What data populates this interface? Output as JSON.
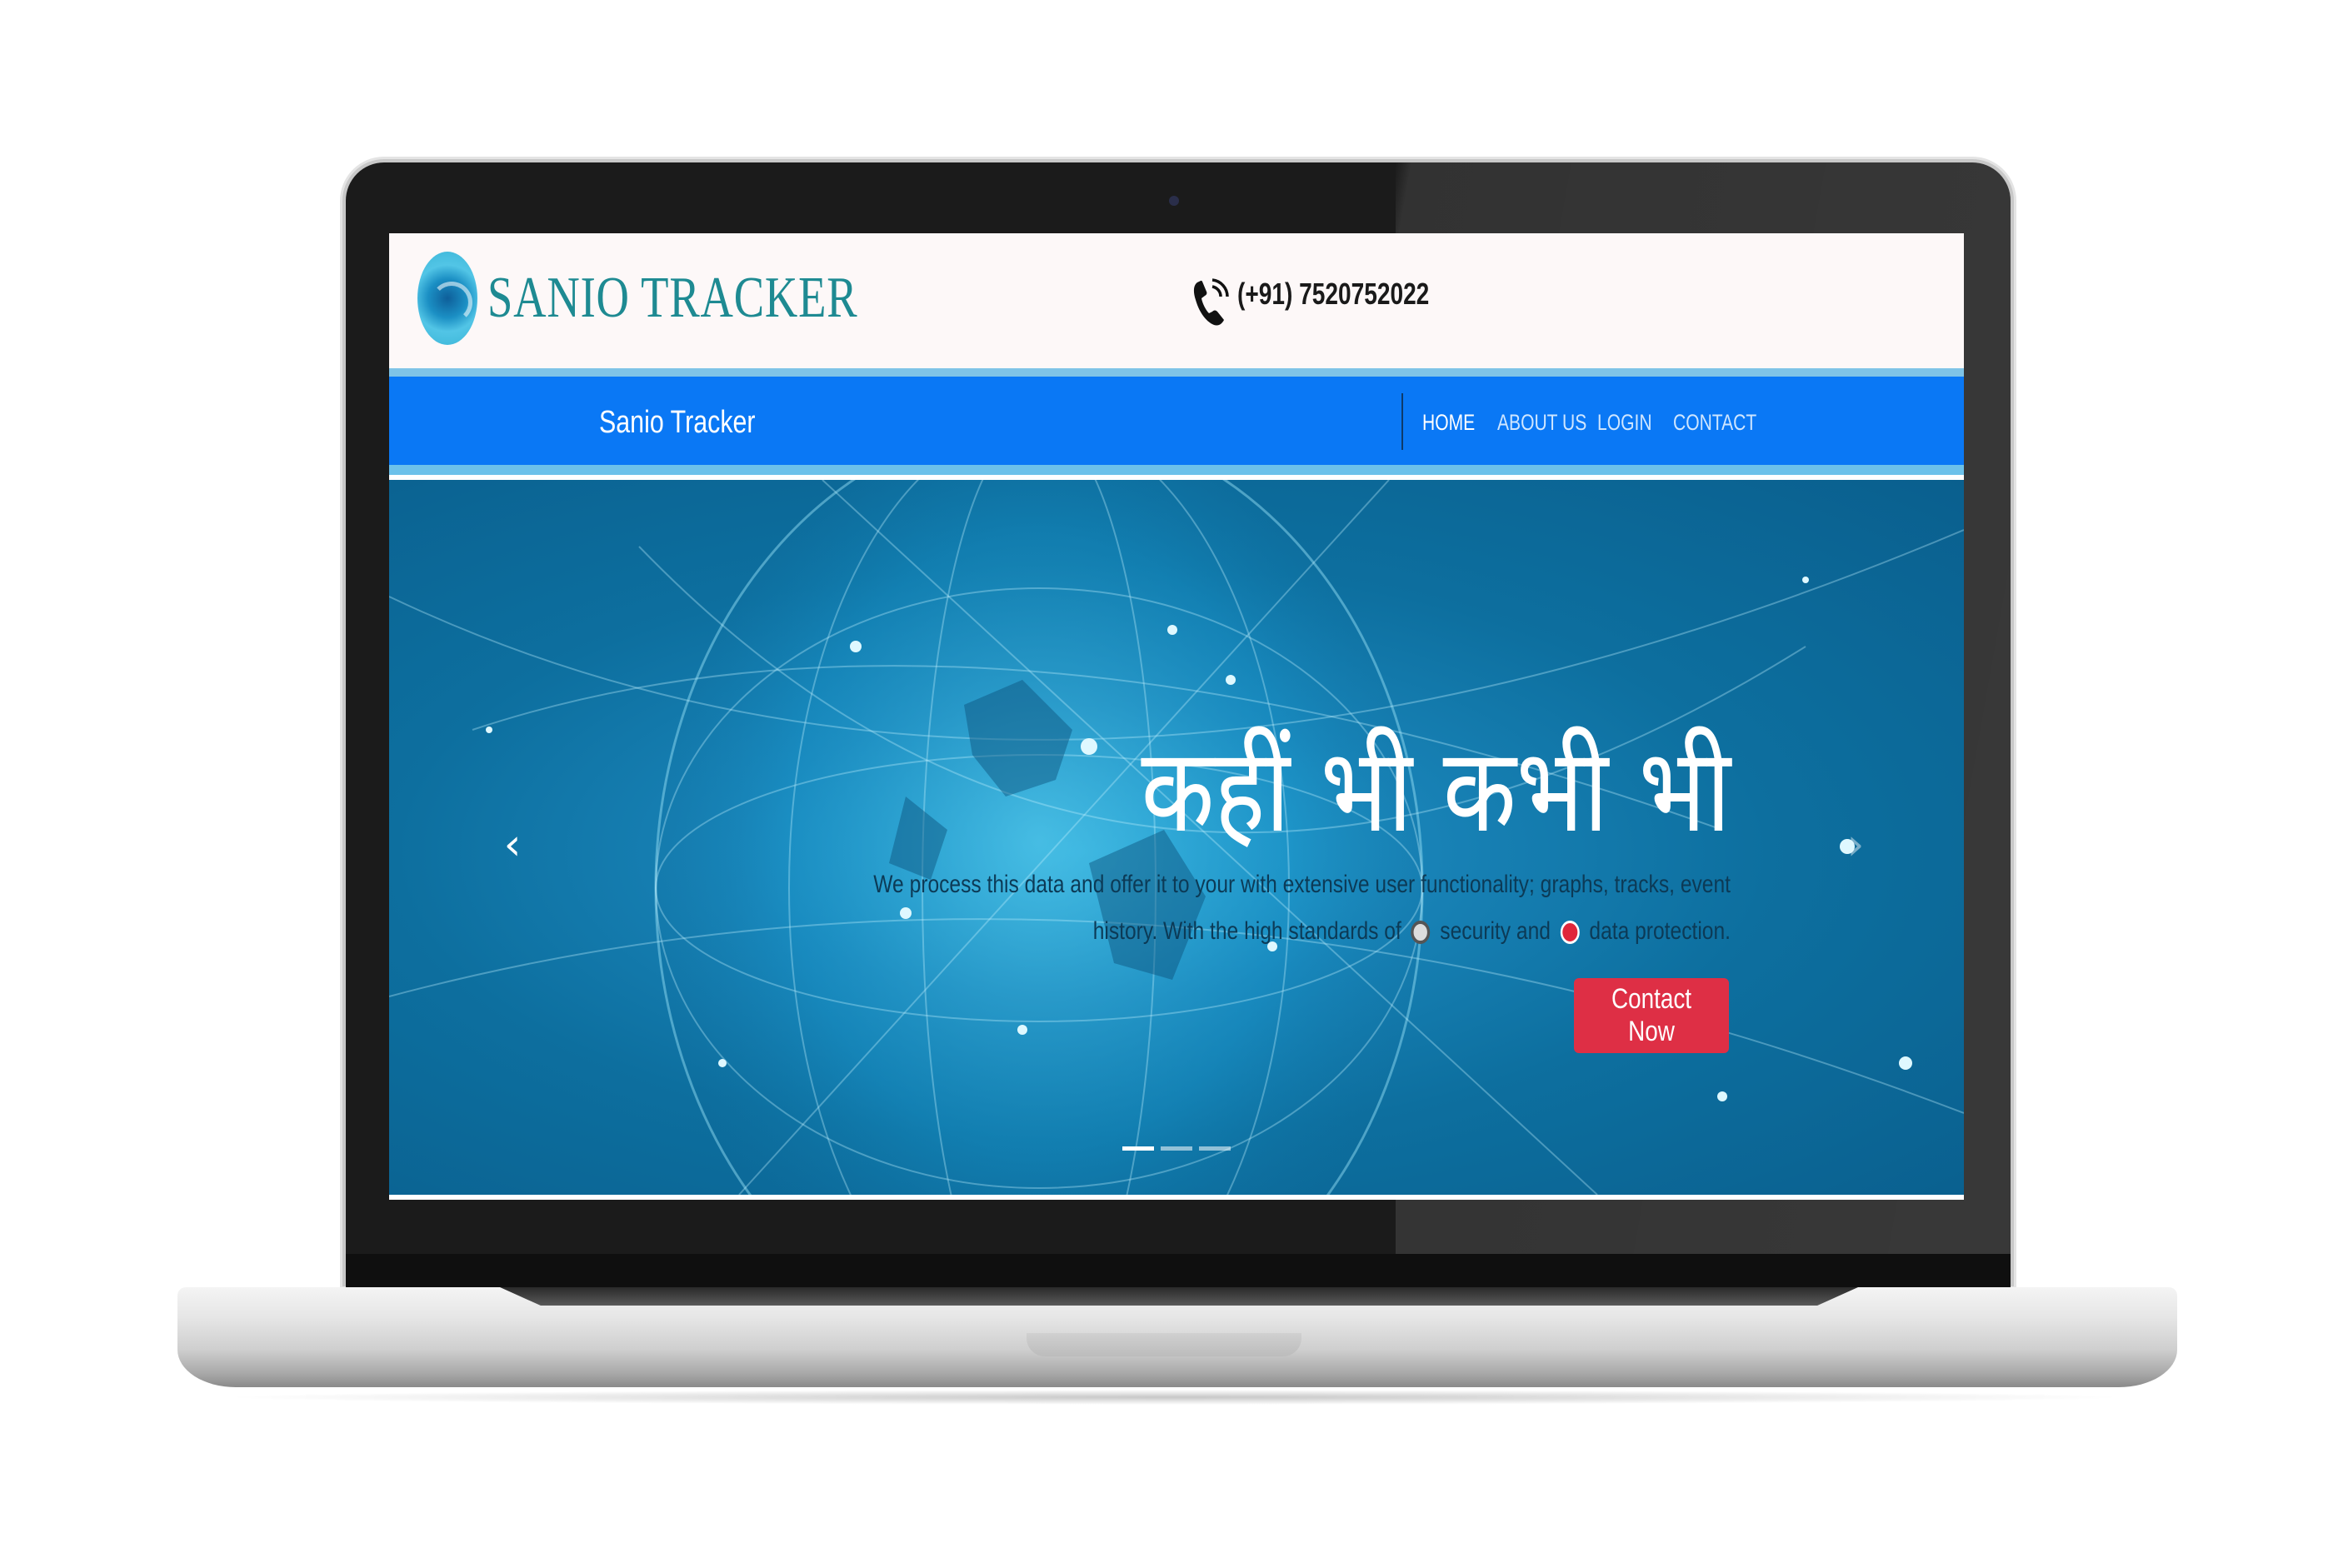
{
  "header": {
    "brand_name": "SANIO TRACKER",
    "phone": "(+91) 7520752022"
  },
  "navbar": {
    "brand": "Sanio Tracker",
    "links": [
      {
        "label": "HOME",
        "active": true
      },
      {
        "label": "ABOUT US",
        "active": false
      },
      {
        "label": "LOGIN",
        "active": false
      },
      {
        "label": "CONTACT",
        "active": false
      }
    ]
  },
  "hero": {
    "title": "कहीं भी कभी भी",
    "text_part1": "We process this data and offer it to your with extensive user functionality; graphs, tracks, event history. With the high standards of",
    "text_part2": "security and",
    "text_part3": "data protection.",
    "cta_label": "Contact Now",
    "prev_glyph": "‹",
    "next_glyph": "›",
    "slide_count": 3,
    "active_slide": 1
  },
  "icons": {
    "logo": "swirl-logo-icon",
    "phone": "phone-ringing-icon",
    "gear": "gear-icon",
    "shield": "shield-icon"
  },
  "colors": {
    "navbar": "#0a78f5",
    "accent_border": "#6cc1ea",
    "brand_text": "#1e8a92",
    "cta": "#de2f45",
    "hero_bg": "#0d6f9f"
  }
}
